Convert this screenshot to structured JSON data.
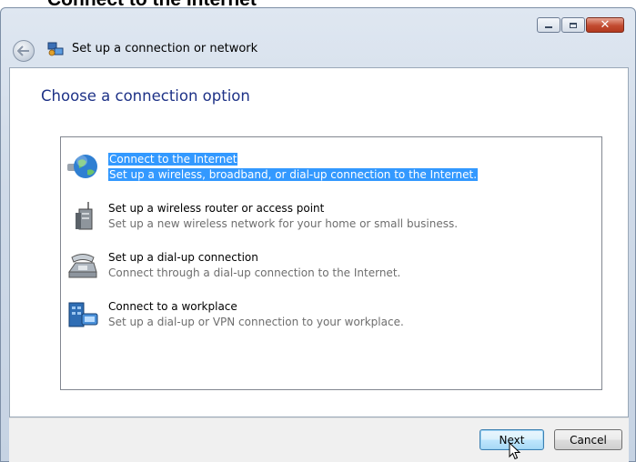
{
  "page_caption": "Connect to the Internet",
  "window": {
    "title": "Set up a connection or network",
    "caption_buttons": {
      "minimize": "minimize",
      "maximize": "maximize",
      "close": "close"
    }
  },
  "heading": "Choose a connection option",
  "options": [
    {
      "title": "Connect to the Internet",
      "description": "Set up a wireless, broadband, or dial-up connection to the Internet.",
      "icon": "globe-icon",
      "selected": true
    },
    {
      "title": "Set up a wireless router or access point",
      "description": "Set up a new wireless network for your home or small business.",
      "icon": "router-icon",
      "selected": false
    },
    {
      "title": "Set up a dial-up connection",
      "description": "Connect through a dial-up connection to the Internet.",
      "icon": "telephone-icon",
      "selected": false
    },
    {
      "title": "Connect to a workplace",
      "description": "Set up a dial-up or VPN connection to your workplace.",
      "icon": "workplace-icon",
      "selected": false
    }
  ],
  "buttons": {
    "next": "Next",
    "cancel": "Cancel"
  },
  "colors": {
    "heading": "#1e3287",
    "selection": "#3399ff"
  }
}
